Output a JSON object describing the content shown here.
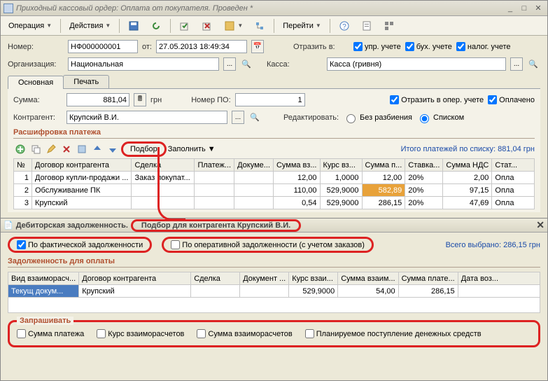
{
  "window": {
    "title": "Приходный кассовый ордер: Оплата от покупателя. Проведен *"
  },
  "toolbar": {
    "operation": "Операция",
    "actions": "Действия",
    "goto": "Перейти"
  },
  "header": {
    "number_lbl": "Номер:",
    "number": "НФ000000001",
    "from_lbl": "от:",
    "date": "27.05.2013 18:49:34",
    "reflect_lbl": "Отразить в:",
    "chk_upr": "упр. учете",
    "chk_bux": "бух. учете",
    "chk_nal": "налог. учете",
    "org_lbl": "Организация:",
    "org": "Национальная",
    "kassa_lbl": "Касса:",
    "kassa": "Касса (гривня)"
  },
  "tabs": {
    "main": "Основная",
    "print": "Печать"
  },
  "main": {
    "sum_lbl": "Сумма:",
    "sum": "881,04",
    "curr": "грн",
    "po_lbl": "Номер ПО:",
    "po": "1",
    "chk_oper": "Отразить в опер. учете",
    "chk_paid": "Оплачено",
    "contr_lbl": "Контрагент:",
    "contr": "Крупский В.И.",
    "edit_lbl": "Редактировать:",
    "radio_norazb": "Без разбиения",
    "radio_list": "Списком"
  },
  "breakdown": {
    "title": "Расшифровка платежа",
    "podbor": "Подбор",
    "fill": "Заполнить",
    "total": "Итого платежей по списку: 881,04 грн",
    "cols": {
      "n": "№",
      "dog": "Договор контрагента",
      "deal": "Сделка",
      "pay": "Платеж...",
      "doc": "Докуме...",
      "sumvz": "Сумма вз...",
      "kurs": "Курс вз...",
      "sump": "Сумма п...",
      "rate": "Ставка...",
      "nds": "Сумма НДС",
      "stat": "Стат..."
    },
    "rows": [
      {
        "n": "1",
        "dog": "Договор купли-продажи ...",
        "deal": "Заказ покупат...",
        "pay": "",
        "doc": "",
        "sumvz": "12,00",
        "kurs": "1,0000",
        "sump": "12,00",
        "rate": "20%",
        "nds": "2,00",
        "stat": "Опла"
      },
      {
        "n": "2",
        "dog": "Обслуживание ПК",
        "deal": "",
        "pay": "",
        "doc": "",
        "sumvz": "110,00",
        "kurs": "529,9000",
        "sump": "582,89",
        "rate": "20%",
        "nds": "97,15",
        "stat": "Опла"
      },
      {
        "n": "3",
        "dog": "Крупский",
        "deal": "",
        "pay": "",
        "doc": "",
        "sumvz": "0,54",
        "kurs": "529,9000",
        "sump": "286,15",
        "rate": "20%",
        "nds": "47,69",
        "stat": "Опла"
      }
    ]
  },
  "sub": {
    "title_prefix": "Дебиторская задолженность.",
    "title_h": "Подбор для контрагента Крупский В.И.",
    "opt1": "По фактической задолженности",
    "opt2": "По оперативной задолженности (с учетом заказов)",
    "total": "Всего выбрано: 286,15 грн",
    "section": "Задолженность для оплаты",
    "cols": {
      "vid": "Вид взаиморасч...",
      "dog": "Договор контрагента",
      "deal": "Сделка",
      "doc": "Документ ...",
      "kurs": "Курс взаи...",
      "sumvz": "Сумма взаим...",
      "sump": "Сумма плате...",
      "date": "Дата воз..."
    },
    "rows": [
      {
        "vid": "Текущ докум...",
        "dog": "Крупский",
        "deal": "",
        "doc": "",
        "kurs": "529,9000",
        "sumvz": "54,00",
        "sump": "286,15",
        "date": ""
      }
    ],
    "ask": {
      "legend": "Запрашивать",
      "c1": "Сумма платежа",
      "c2": "Курс взаиморасчетов",
      "c3": "Сумма взаиморасчетов",
      "c4": "Планируемое поступление денежных средств"
    }
  }
}
